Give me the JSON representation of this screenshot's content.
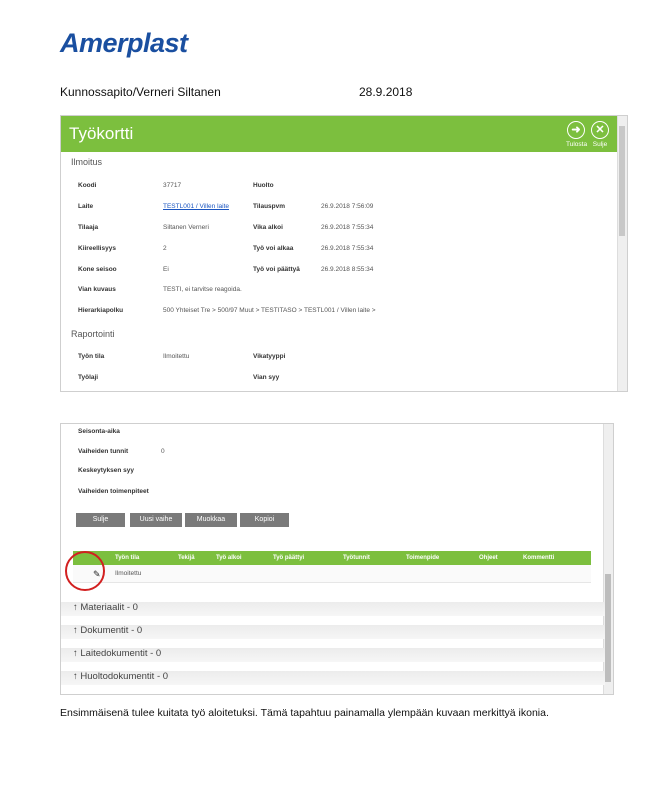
{
  "header": {
    "logo_text": "Amerplast",
    "author_line": "Kunnossapito/Verneri Siltanen",
    "date": "28.9.2018"
  },
  "panel1": {
    "title": "Työkortti",
    "print_label": "Tulosta",
    "close_label": "Sulje",
    "section_notice": "Ilmoitus",
    "section_report": "Raportointi",
    "fields": {
      "koodi_label": "Koodi",
      "koodi_value": "37717",
      "huolto_label": "Huolto",
      "laite_label": "Laite",
      "laite_value": "TESTL001 / Villen laite",
      "tilauspvm_label": "Tilauspvm",
      "tilauspvm_value": "26.9.2018 7:56:09",
      "tilaaja_label": "Tilaaja",
      "tilaaja_value": "Siltanen Verneri",
      "vika_alkoi_label": "Vika alkoi",
      "vika_alkoi_value": "26.9.2018 7:55:34",
      "kiireellisyys_label": "Kiireellisyys",
      "kiireellisyys_value": "2",
      "tyo_voi_alkaa_label": "Työ voi alkaa",
      "tyo_voi_alkaa_value": "26.9.2018 7:55:34",
      "kone_seisoo_label": "Kone seisoo",
      "kone_seisoo_value": "Ei",
      "tyo_voi_paattya_label": "Työ voi päättyä",
      "tyo_voi_paattya_value": "26.9.2018 8:55:34",
      "vian_kuvaus_label": "Vian kuvaus",
      "vian_kuvaus_value": "TESTI, ei tarvitse reagoida.",
      "hierarkiapolku_label": "Hierarkiapolku",
      "hierarkiapolku_value": "500 Yhteiset Tre > 500/97 Muut > TESTITASO > TESTL001 / Villen laite >",
      "tyon_tila_label": "Työn tila",
      "tyon_tila_value": "Ilmoitettu",
      "vikatyyppi_label": "Vikatyyppi",
      "tyolaji_label": "Työlaji",
      "vian_syy_label": "Vian syy"
    }
  },
  "panel2": {
    "seisonta_aika_label": "Seisonta-aika",
    "vaiheiden_tunnit_label": "Vaiheiden tunnit",
    "vaiheiden_tunnit_value": "0",
    "keskeytyksen_syy_label": "Keskeytyksen syy",
    "vaiheiden_toimenpiteet_label": "Vaiheiden toimenpiteet",
    "buttons": {
      "close": "Sulje",
      "new_phase": "Uusi vaihe",
      "edit": "Muokkaa",
      "copy": "Kopioi"
    },
    "grid_headers": [
      "Työn tila",
      "Tekijä",
      "Työ alkoi",
      "Työ päättyi",
      "Työtunnit",
      "Toimenpide",
      "Ohjeet",
      "Kommentti"
    ],
    "grid_row_status": "Ilmoitettu",
    "accordions": [
      "↑ Materiaalit - 0",
      "↑ Dokumentit - 0",
      "↑ Laitedokumentit - 0",
      "↑ Huoltodokumentit - 0"
    ]
  },
  "footer_text": "Ensimmäisenä tulee kuitata työ aloitetuksi. Tämä tapahtuu painamalla ylempään kuvaan merkittyä ikonia.",
  "colors": {
    "brand": "#1a4fa0",
    "accent_green": "#7cbf3e",
    "highlight_red": "#d22020"
  }
}
